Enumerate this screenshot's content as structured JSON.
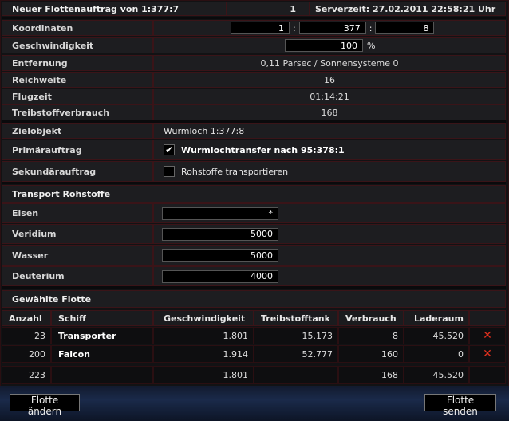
{
  "header": {
    "title": "Neuer Flottenauftrag von 1:377:7",
    "number": "1",
    "server_time": "Serverzeit: 27.02.2011 22:58:21 Uhr"
  },
  "coords": {
    "label": "Koordinaten",
    "x": "1",
    "y": "377",
    "z": "8",
    "sep": ":"
  },
  "speed": {
    "label": "Geschwindigkeit",
    "value": "100",
    "unit": "%"
  },
  "distance": {
    "label": "Entfernung",
    "value": "0,11 Parsec / Sonnensysteme 0"
  },
  "range": {
    "label": "Reichweite",
    "value": "16"
  },
  "flighttime": {
    "label": "Flugzeit",
    "value": "01:14:21"
  },
  "fuel": {
    "label": "Treibstoffverbrauch",
    "value": "168"
  },
  "target": {
    "label": "Zielobjekt",
    "value": "Wurmloch 1:377:8"
  },
  "primary": {
    "label": "Primärauftrag",
    "value": "Wurmlochtransfer nach 95:378:1",
    "checked": "✔"
  },
  "secondary": {
    "label": "Sekundärauftrag",
    "value": "Rohstoffe transportieren"
  },
  "transport": {
    "title": "Transport Rohstoffe",
    "rows": [
      {
        "label": "Eisen",
        "value": "*"
      },
      {
        "label": "Veridium",
        "value": "5000"
      },
      {
        "label": "Wasser",
        "value": "5000"
      },
      {
        "label": "Deuterium",
        "value": "4000"
      }
    ]
  },
  "fleet": {
    "title": "Gewählte Flotte",
    "columns": [
      "Anzahl",
      "Schiff",
      "Geschwindigkeit",
      "Treibstofftank",
      "Verbrauch",
      "Laderaum"
    ],
    "rows": [
      {
        "count": "23",
        "ship": "Transporter",
        "speed": "1.801",
        "tank": "15.173",
        "usage": "8",
        "cargo": "45.520"
      },
      {
        "count": "200",
        "ship": "Falcon",
        "speed": "1.914",
        "tank": "52.777",
        "usage": "160",
        "cargo": "0"
      }
    ],
    "total": {
      "count": "223",
      "speed": "1.801",
      "usage": "168",
      "cargo": "45.520"
    },
    "delete_icon": "✕"
  },
  "buttons": {
    "change": "Flotte ändern",
    "send": "Flotte senden"
  }
}
